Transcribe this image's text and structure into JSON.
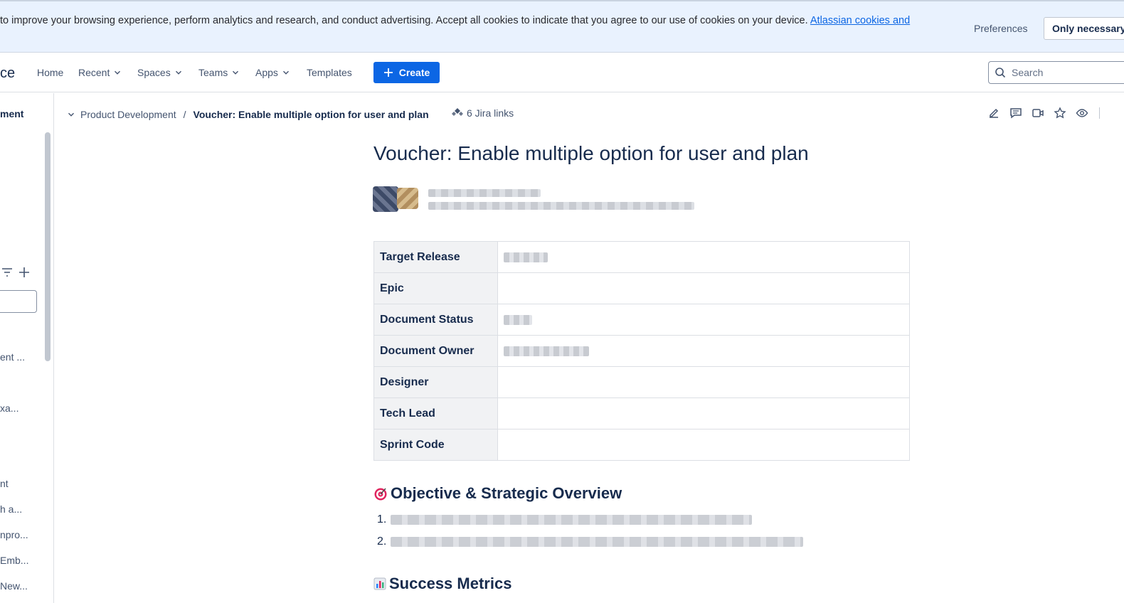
{
  "cookie_banner": {
    "text": " to improve your browsing experience, perform analytics and research, and conduct advertising. Accept all cookies to indicate that you agree to our use of cookies on your device. ",
    "link": "Atlassian cookies and",
    "preferences": "Preferences",
    "only_necessary": "Only necessary"
  },
  "nav": {
    "brand_fragment": "ce",
    "home": "Home",
    "recent": "Recent",
    "spaces": "Spaces",
    "teams": "Teams",
    "apps": "Apps",
    "templates": "Templates",
    "create": "Create",
    "search_placeholder": "Search"
  },
  "sidebar": {
    "title_fragment": "ment",
    "items": [
      "ent ...",
      "xa...",
      "nt",
      "h a...",
      "npro...",
      "Emb...",
      "New..."
    ]
  },
  "breadcrumb": {
    "parent": "Product Development",
    "separator": "/",
    "current": "Voucher: Enable multiple option for user and plan",
    "jira_links": "6 Jira links"
  },
  "page": {
    "title": "Voucher: Enable multiple option for user and plan",
    "properties": [
      {
        "key": "Target Release",
        "value_blurred": true
      },
      {
        "key": "Epic",
        "value_blurred": false
      },
      {
        "key": "Document Status",
        "value_blurred": true
      },
      {
        "key": "Document Owner",
        "value_blurred": true
      },
      {
        "key": "Designer",
        "value_blurred": false
      },
      {
        "key": "Tech Lead",
        "value_blurred": false
      },
      {
        "key": "Sprint Code",
        "value_blurred": false
      }
    ],
    "objective_heading": "Objective & Strategic Overview",
    "objective_items": [
      "1.",
      "2."
    ],
    "metrics_heading": "Success Metrics"
  },
  "colors": {
    "accent": "#0c66e4",
    "banner_bg": "#e9f2fe",
    "text": "#172b4d",
    "subtle": "#44546f"
  },
  "icons": [
    "chevron-down-icon",
    "plus-icon",
    "search-icon",
    "filter-icon",
    "jira-icon",
    "edit-icon",
    "comment-icon",
    "video-icon",
    "star-icon",
    "eye-icon",
    "target-emoji-icon",
    "bar-chart-emoji-icon"
  ]
}
